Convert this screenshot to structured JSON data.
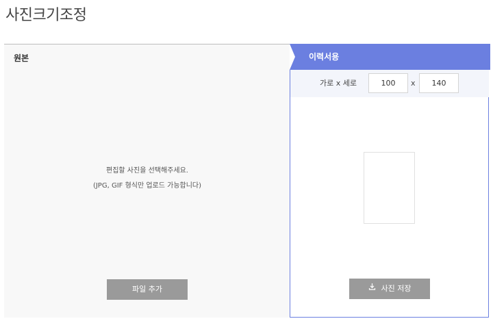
{
  "page": {
    "title": "사진크기조정"
  },
  "left": {
    "tab_label": "원본",
    "message_line1": "편집할 사진을 선택해주세요.",
    "message_line2": "(JPG, GIF 형식만 업로드 가능합니다)",
    "add_file_label": "파일 추가"
  },
  "right": {
    "tab_label": "이력서용",
    "size_label": "가로 x 세로",
    "width_value": "100",
    "times": "x",
    "height_value": "140",
    "save_label": "사진 저장",
    "save_icon": "download-icon"
  },
  "colors": {
    "accent": "#6b7fe0",
    "button": "#9a9a9a",
    "left_bg": "#f8f8f8"
  }
}
